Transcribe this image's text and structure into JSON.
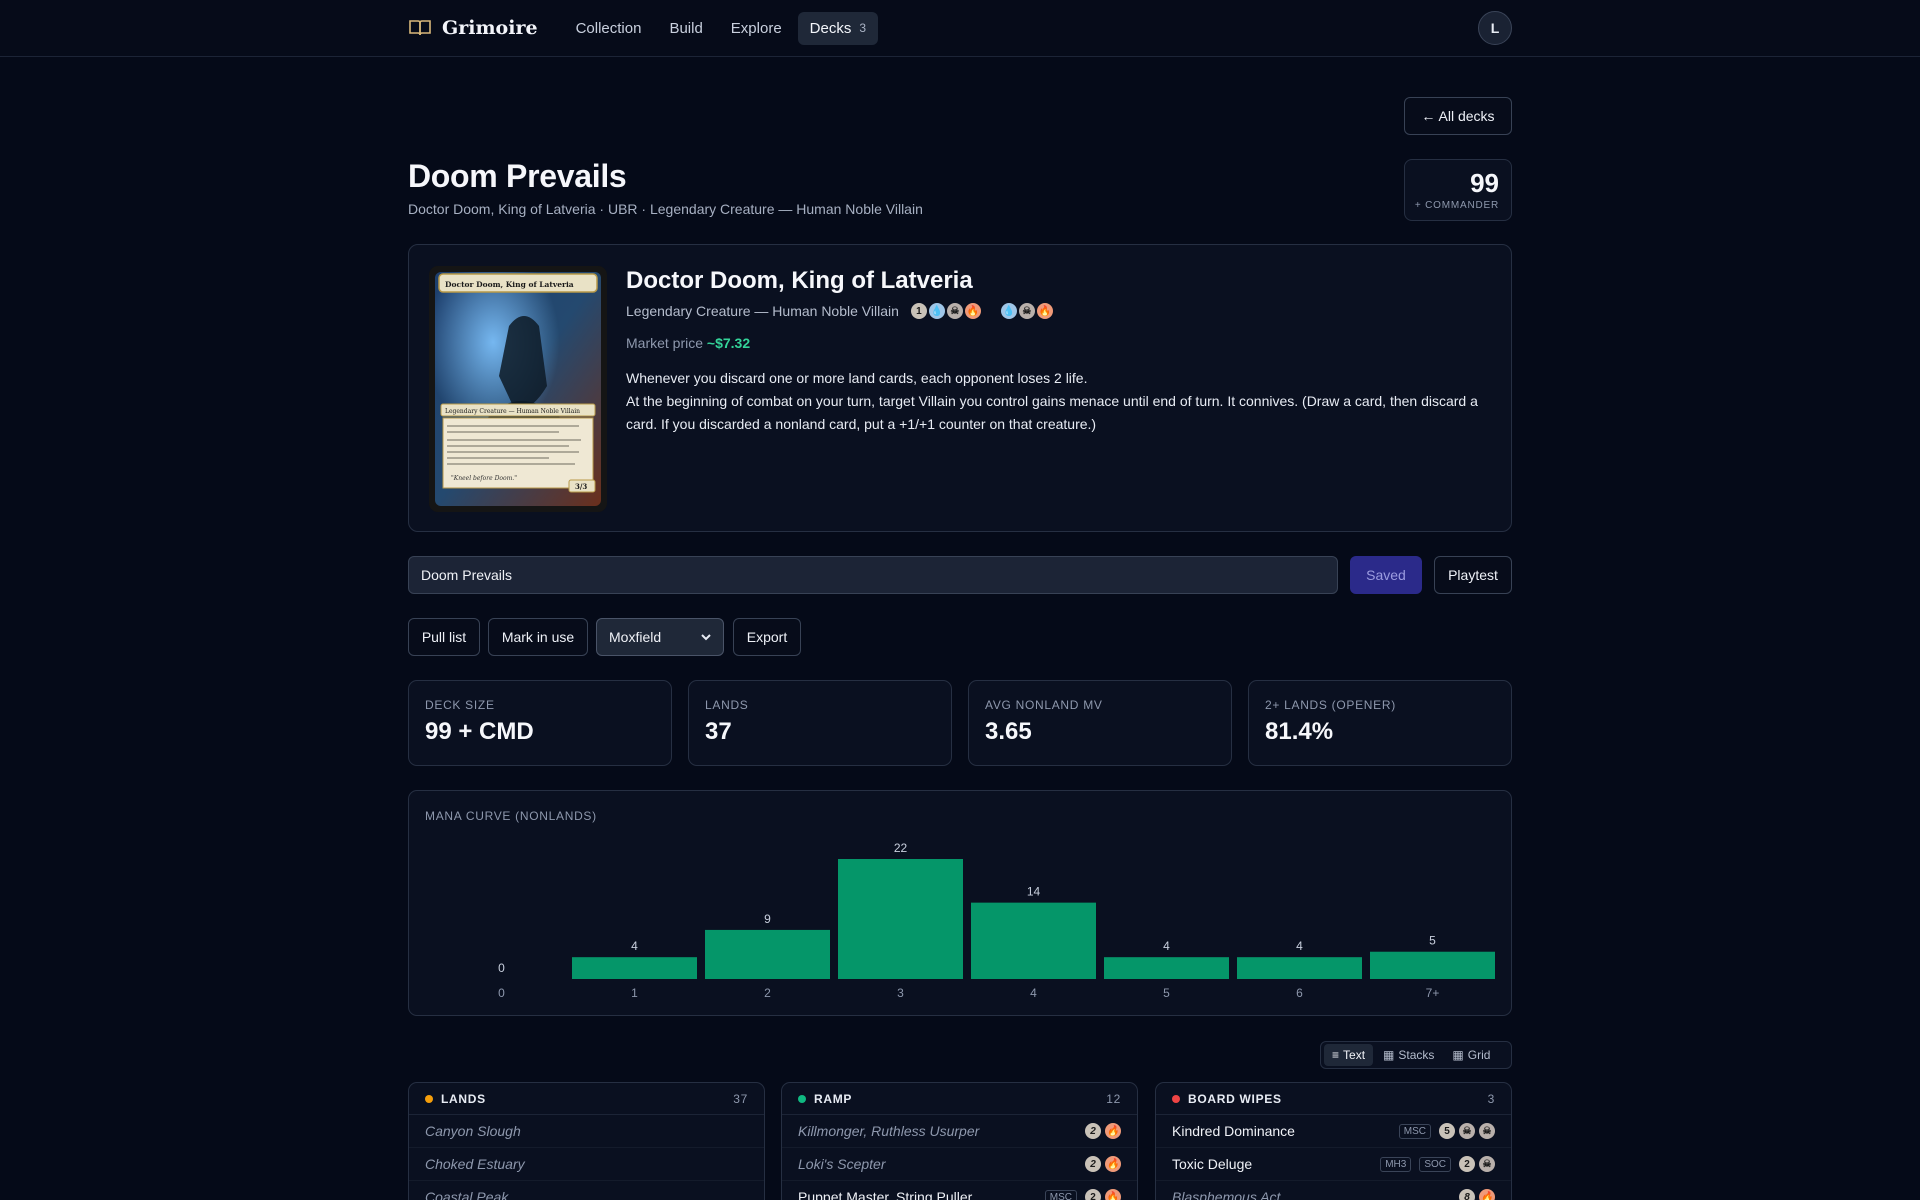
{
  "nav": {
    "logo": "Grimoire",
    "items": [
      {
        "label": "Collection"
      },
      {
        "label": "Build"
      },
      {
        "label": "Explore"
      },
      {
        "label": "Decks",
        "count": "3"
      }
    ],
    "avatar": "L"
  },
  "header": {
    "back_label": "← All decks",
    "title": "Doom Prevails",
    "subtitle": "Doctor Doom, King of Latveria · UBR · Legendary Creature — Human Noble Villain",
    "count": "99",
    "count_label": "+ COMMANDER"
  },
  "commander": {
    "name": "Doctor Doom, King of Latveria",
    "type_line": "Legendary Creature — Human Noble Villain",
    "mana_cost": [
      "1",
      "U",
      "B",
      "R"
    ],
    "color_identity": [
      "U",
      "B",
      "R"
    ],
    "market_label": "Market price",
    "market_price": "~$7.32",
    "rules_1": "Whenever you discard one or more land cards, each opponent loses 2 life.",
    "rules_2": "At the beginning of combat on your turn, target Villain you control gains menace until end of turn. It connives. (Draw a card, then discard a card. If you discarded a nonland card, put a +1/+1 counter on that creature.)",
    "art_card": {
      "name": "Doctor Doom, King of Latveria",
      "type": "Legendary Creature — Human Noble Villain",
      "pt": "3/3",
      "flavor": "\"Kneel before Doom.\""
    }
  },
  "deck_name_input": {
    "value": "Doom Prevails"
  },
  "actions": {
    "saved": "Saved",
    "playtest": "Playtest",
    "pull_list": "Pull list",
    "mark_in_use": "Mark in use",
    "export_format": "Moxfield",
    "export": "Export"
  },
  "stats": [
    {
      "label": "DECK SIZE",
      "value": "99 + CMD"
    },
    {
      "label": "LANDS",
      "value": "37"
    },
    {
      "label": "AVG NONLAND MV",
      "value": "3.65"
    },
    {
      "label": "2+ LANDS (OPENER)",
      "value": "81.4%"
    }
  ],
  "chart_data": {
    "type": "bar",
    "title": "MANA CURVE (NONLANDS)",
    "categories": [
      "0",
      "1",
      "2",
      "3",
      "4",
      "5",
      "6",
      "7+"
    ],
    "values": [
      0,
      4,
      9,
      22,
      14,
      4,
      4,
      5
    ],
    "bar_color": "#059669",
    "ylim": [
      0,
      22
    ]
  },
  "view_toggle": [
    "Text",
    "Stacks",
    "Grid"
  ],
  "panels": [
    {
      "title": "LANDS",
      "count": "37",
      "color": "#f59e0b",
      "rows": [
        {
          "name": "Canyon Slough",
          "italic": true,
          "sets": [],
          "cost": []
        },
        {
          "name": "Choked Estuary",
          "italic": true,
          "sets": [],
          "cost": []
        },
        {
          "name": "Coastal Peak",
          "italic": true,
          "sets": [],
          "cost": []
        }
      ]
    },
    {
      "title": "RAMP",
      "count": "12",
      "color": "#10b981",
      "rows": [
        {
          "name": "Killmonger, Ruthless Usurper",
          "italic": true,
          "sets": [],
          "cost": [
            "2",
            "R"
          ]
        },
        {
          "name": "Loki's Scepter",
          "italic": true,
          "sets": [],
          "cost": [
            "2",
            "R"
          ]
        },
        {
          "name": "Puppet Master, String Puller",
          "italic": false,
          "sets": [
            "MSC"
          ],
          "cost": [
            "2",
            "R"
          ]
        }
      ]
    },
    {
      "title": "BOARD WIPES",
      "count": "3",
      "color": "#ef4444",
      "rows": [
        {
          "name": "Kindred Dominance",
          "italic": false,
          "sets": [
            "MSC"
          ],
          "cost": [
            "5",
            "B",
            "B"
          ]
        },
        {
          "name": "Toxic Deluge",
          "italic": false,
          "sets": [
            "MH3",
            "SOC"
          ],
          "cost": [
            "2",
            "B"
          ]
        },
        {
          "name": "Blasphemous Act",
          "italic": true,
          "sets": [],
          "cost": [
            "8",
            "R"
          ]
        }
      ]
    }
  ]
}
